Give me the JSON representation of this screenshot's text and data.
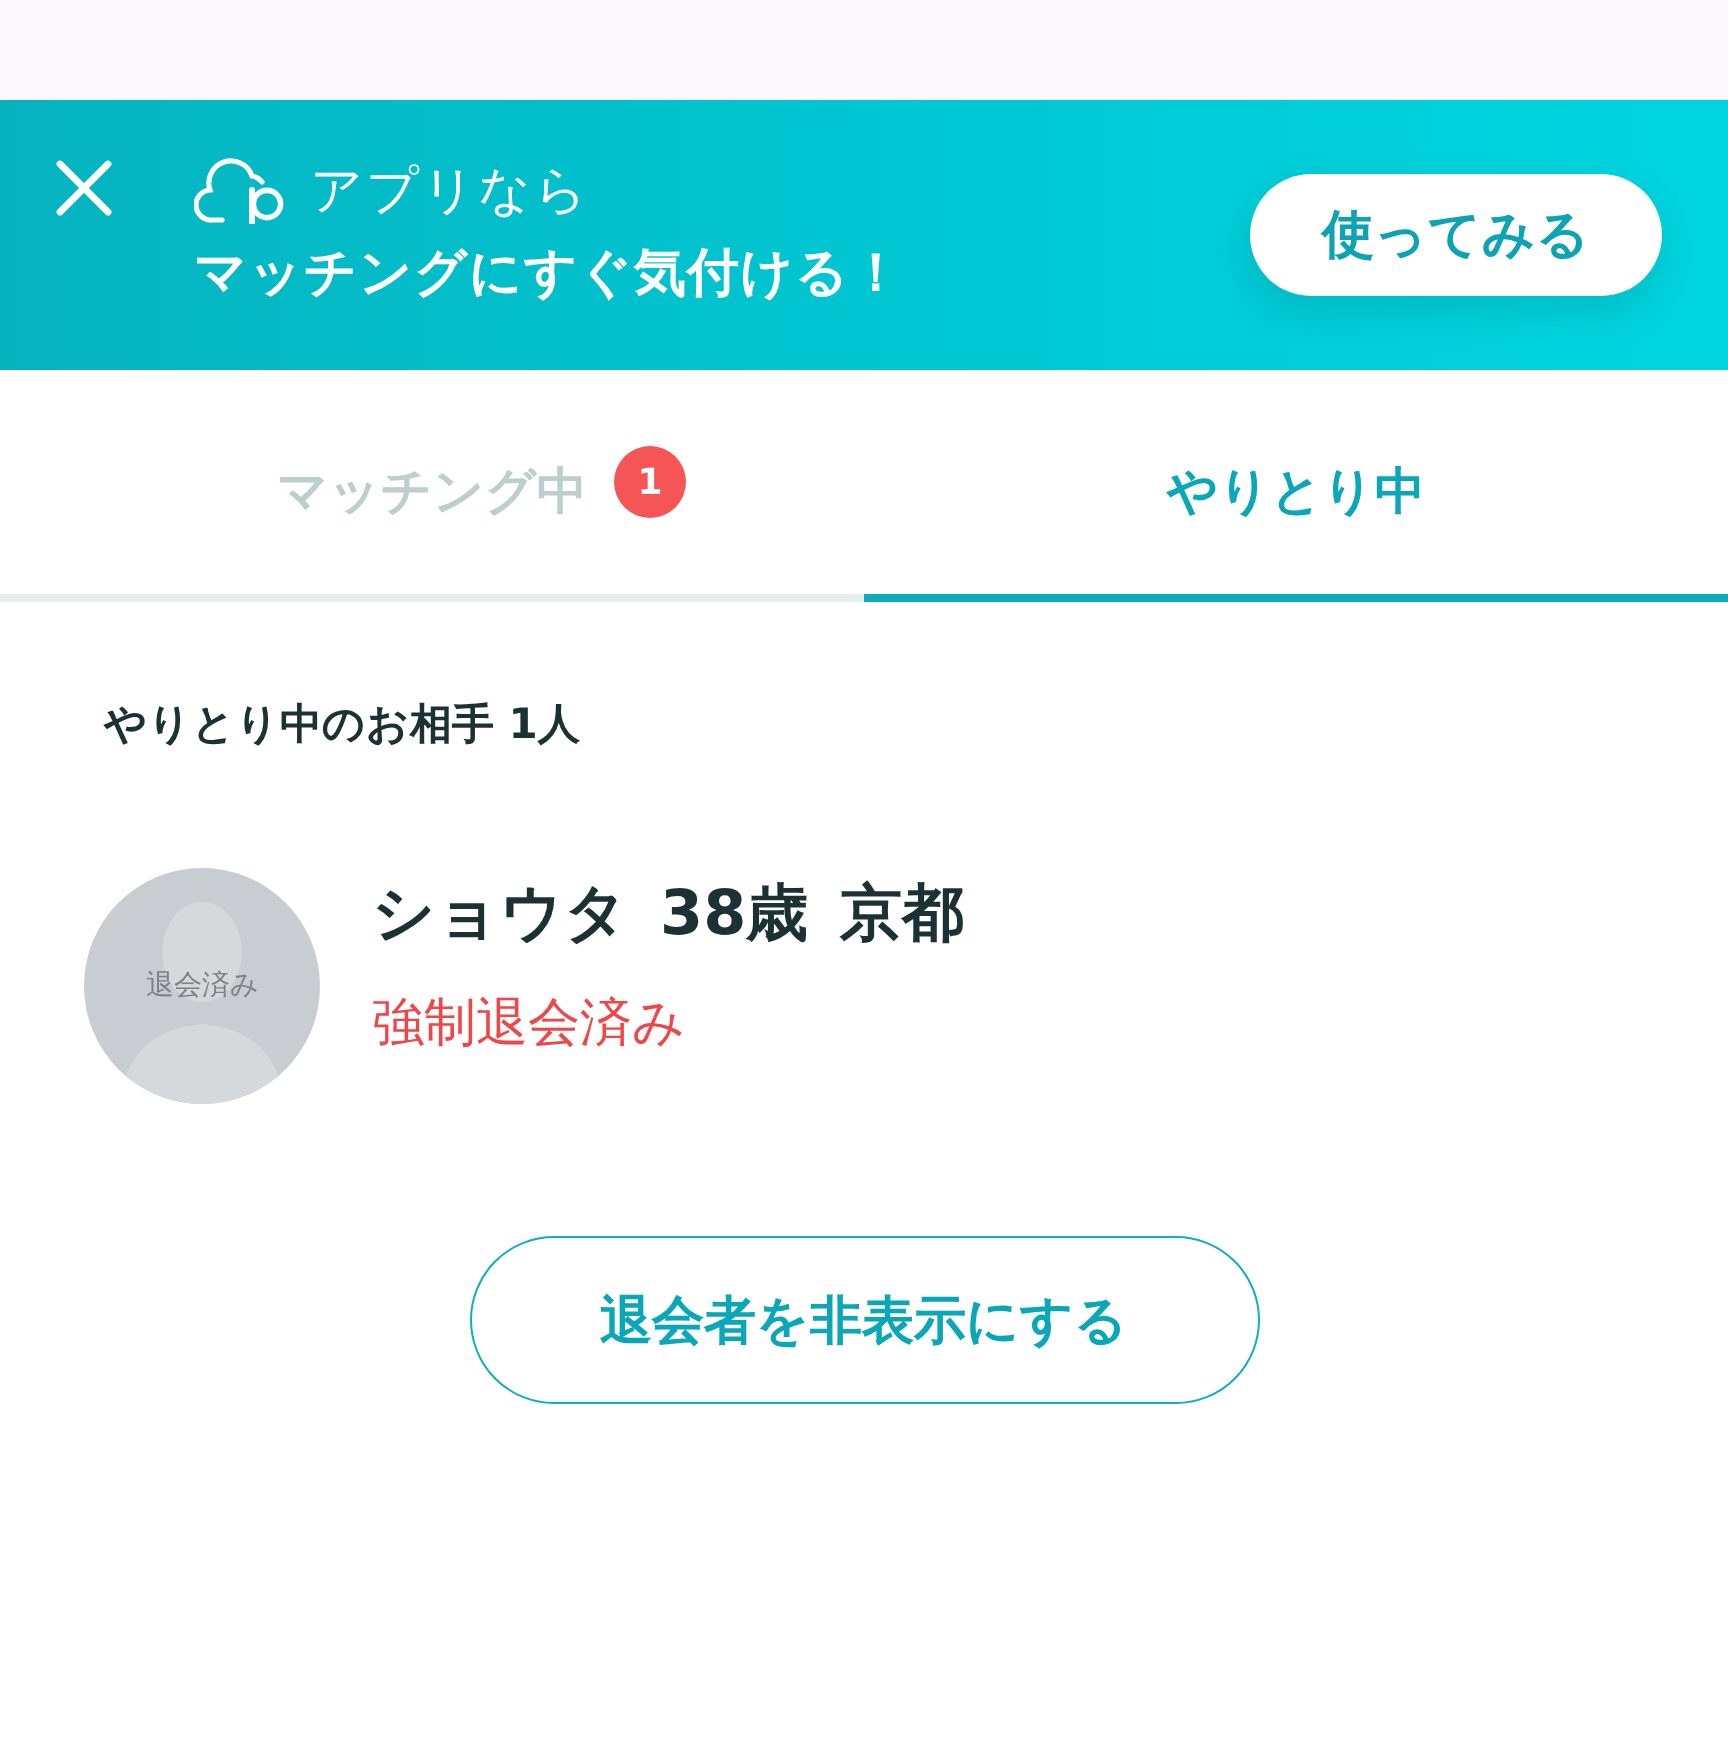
{
  "app_banner": {
    "headline": "アプリなら",
    "message": "マッチングにすぐ気付ける！",
    "button": "使ってみる"
  },
  "tabs": [
    {
      "label": "マッチング中",
      "badge": "1",
      "selected": false
    },
    {
      "label": "やりとり中",
      "selected": true
    }
  ],
  "section": {
    "heading": "やりとり中のお相手 1人"
  },
  "partners": [
    {
      "avatar_label": "退会済み",
      "name": "ショウタ",
      "age": "38歳",
      "location": "京都",
      "status": "強制退会済み"
    }
  ],
  "hide_button": "退会者を非表示にする"
}
